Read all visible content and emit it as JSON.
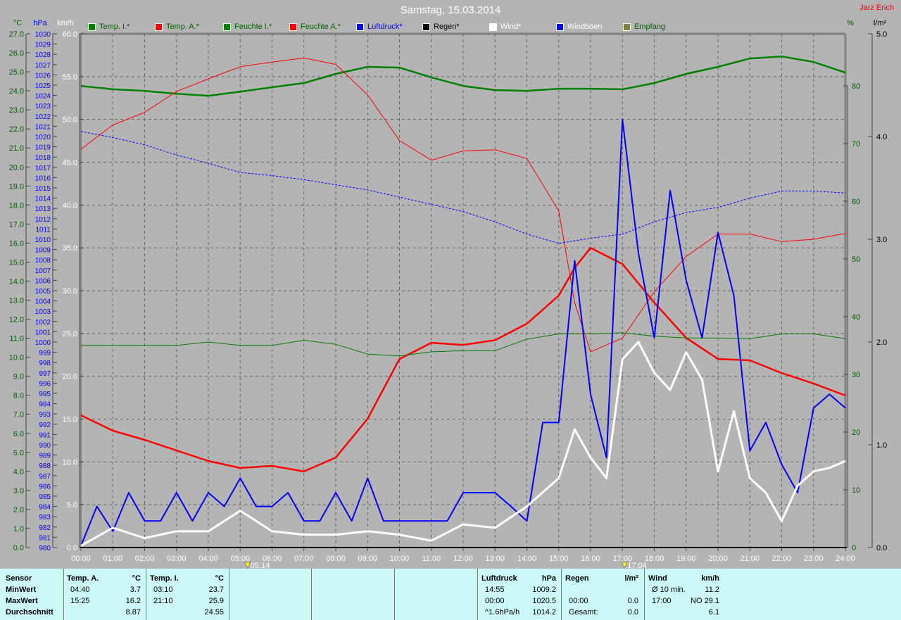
{
  "title": "Samstag, 15.03.2014",
  "author": "Jarz Erich",
  "legend": [
    {
      "label": "Temp. I.*",
      "color": "#008000",
      "text": "#006000"
    },
    {
      "label": "Temp. A.*",
      "color": "#ff0000",
      "text": "#006000"
    },
    {
      "label": "Feuchte I.*",
      "color": "#008000",
      "text": "#006000"
    },
    {
      "label": "Feuchte A.*",
      "color": "#ff0000",
      "text": "#006000"
    },
    {
      "label": "Luftdruck*",
      "color": "#0000ff",
      "text": "#0000ff"
    },
    {
      "label": "Regen*",
      "color": "#000000",
      "text": "#000000"
    },
    {
      "label": "Wind*",
      "color": "#ffffff",
      "text": "#ffffff"
    },
    {
      "label": "Windböen",
      "color": "#0000ff",
      "text": "#ffffff"
    },
    {
      "label": "Empfang",
      "color": "#808040",
      "text": "#006000"
    }
  ],
  "markers": {
    "sunrise": "05:14",
    "sunset": "17:04"
  },
  "chart_data": {
    "type": "line",
    "title": "Samstag, 15.03.2014",
    "x_labels": [
      "00:00",
      "01:00",
      "02:00",
      "03:00",
      "04:00",
      "05:00",
      "06:00",
      "07:00",
      "08:00",
      "09:00",
      "10:00",
      "11:00",
      "12:00",
      "13:00",
      "14:00",
      "15:00",
      "16:00",
      "17:00",
      "18:00",
      "19:00",
      "20:00",
      "21:00",
      "22:00",
      "23:00",
      "24:00"
    ],
    "xlim": [
      0,
      24
    ],
    "axes": {
      "celsius": {
        "unit": "°C",
        "range": [
          0,
          27
        ],
        "ticks": [
          "0.0",
          "1.0",
          "2.0",
          "3.0",
          "4.0",
          "5.0",
          "6.0",
          "7.0",
          "8.0",
          "9.0",
          "10.0",
          "11.0",
          "12.0",
          "13.0",
          "14.0",
          "15.0",
          "16.0",
          "17.0",
          "18.0",
          "19.0",
          "20.0",
          "21.0",
          "22.0",
          "23.0",
          "24.0",
          "25.0",
          "26.0",
          "27.0"
        ]
      },
      "hpa": {
        "unit": "hPa",
        "range": [
          980,
          1030
        ],
        "ticks": [
          "980",
          "981",
          "982",
          "983",
          "984",
          "985",
          "986",
          "987",
          "988",
          "989",
          "990",
          "991",
          "992",
          "993",
          "994",
          "995",
          "996",
          "997",
          "998",
          "999",
          "1000",
          "1001",
          "1002",
          "1003",
          "1004",
          "1005",
          "1006",
          "1007",
          "1008",
          "1009",
          "1010",
          "1011",
          "1012",
          "1013",
          "1014",
          "1015",
          "1016",
          "1017",
          "1018",
          "1019",
          "1020",
          "1021",
          "1022",
          "1023",
          "1024",
          "1025",
          "1026",
          "1027",
          "1028",
          "1029",
          "1030"
        ]
      },
      "kmh": {
        "unit": "km/h",
        "range": [
          0,
          60
        ],
        "ticks": [
          "0.0",
          "5.0",
          "10.0",
          "15.0",
          "20.0",
          "25.0",
          "30.0",
          "35.0",
          "40.0",
          "45.0",
          "50.0",
          "55.0",
          "60.0"
        ]
      },
      "percent": {
        "unit": "%",
        "range": [
          0,
          89
        ],
        "ticks": [
          "0",
          "10",
          "20",
          "30",
          "40",
          "50",
          "60",
          "70",
          "80"
        ]
      },
      "rain": {
        "unit": "l/m²",
        "range": [
          0,
          5
        ],
        "ticks": [
          "0.0",
          "1.0",
          "2.0",
          "3.0",
          "4.0",
          "5.0"
        ]
      }
    },
    "series": [
      {
        "name": "Temp. A.",
        "axis": "celsius",
        "color": "#ff0000",
        "width": 2.5,
        "x": [
          0,
          1,
          2,
          3,
          4,
          5,
          6,
          7,
          8,
          9,
          10,
          11,
          12,
          13,
          14,
          15,
          15.5,
          16,
          17,
          18,
          19,
          20,
          21,
          22,
          23,
          24
        ],
        "y": [
          6.95,
          6.14,
          5.66,
          5.1,
          4.55,
          4.18,
          4.29,
          4.0,
          4.73,
          6.77,
          9.91,
          10.76,
          10.65,
          10.9,
          11.76,
          13.24,
          14.7,
          15.75,
          14.9,
          12.87,
          11.02,
          9.91,
          9.84,
          9.17,
          8.62,
          7.99
        ]
      },
      {
        "name": "Temp. I.",
        "axis": "celsius",
        "color": "#008000",
        "width": 2.5,
        "x": [
          0,
          1,
          2,
          3,
          4,
          5,
          6,
          7,
          8,
          9,
          10,
          11,
          12,
          13,
          14,
          15,
          16,
          17,
          18,
          19,
          20,
          21,
          22,
          23,
          24
        ],
        "y": [
          24.26,
          24.08,
          24.0,
          23.85,
          23.74,
          23.96,
          24.19,
          24.41,
          24.89,
          25.26,
          25.22,
          24.71,
          24.26,
          24.04,
          24.0,
          24.11,
          24.11,
          24.08,
          24.41,
          24.89,
          25.26,
          25.7,
          25.81,
          25.52,
          24.96
        ]
      },
      {
        "name": "Feuchte A.",
        "axis": "percent",
        "color": "#ff0000",
        "width": 1,
        "x": [
          0,
          1,
          2,
          3,
          4,
          5,
          6,
          7,
          8,
          9,
          10,
          11,
          12,
          13,
          14,
          15,
          15.5,
          16,
          17,
          18,
          19,
          20,
          21,
          22,
          23,
          24
        ],
        "y": [
          69.0,
          73.2,
          75.4,
          79.0,
          81.2,
          83.3,
          84.1,
          84.8,
          83.7,
          78.4,
          70.5,
          67.1,
          68.7,
          68.9,
          67.4,
          58.3,
          42.4,
          33.9,
          36.3,
          44.3,
          50.4,
          54.3,
          54.3,
          53.0,
          53.4,
          54.4
        ]
      },
      {
        "name": "Feuchte I.",
        "axis": "percent",
        "color": "#008000",
        "width": 1,
        "x": [
          0,
          3,
          4,
          5,
          6,
          7,
          8,
          9,
          10,
          11,
          12,
          13,
          14,
          15,
          16,
          17,
          18,
          19,
          20,
          21,
          22,
          23,
          24
        ],
        "y": [
          35.0,
          35.0,
          35.6,
          35.0,
          35.0,
          35.9,
          35.2,
          33.5,
          33.2,
          33.9,
          34.1,
          34.1,
          36.1,
          37.0,
          37.0,
          37.2,
          36.6,
          36.3,
          36.3,
          36.2,
          37.0,
          37.0,
          36.2
        ]
      },
      {
        "name": "Luftdruck",
        "axis": "hpa",
        "color": "#0000ff",
        "width": 1,
        "dash": "3,2",
        "x": [
          0,
          1,
          2,
          3,
          4,
          5,
          6,
          7,
          8,
          9,
          10,
          11,
          12,
          13,
          14,
          15,
          16,
          17,
          18,
          19,
          20,
          21,
          22,
          23,
          24
        ],
        "y": [
          1020.5,
          1019.9,
          1019.2,
          1018.2,
          1017.4,
          1016.5,
          1016.2,
          1015.8,
          1015.3,
          1014.8,
          1014.1,
          1013.4,
          1012.7,
          1011.7,
          1010.5,
          1009.6,
          1010.1,
          1010.5,
          1011.7,
          1012.6,
          1013.1,
          1014.0,
          1014.7,
          1014.7,
          1014.5
        ]
      },
      {
        "name": "Windböen",
        "axis": "kmh",
        "color": "#0000ff",
        "width": 2,
        "x": [
          0,
          0.5,
          1,
          1.5,
          2,
          2.5,
          3,
          3.5,
          4,
          4.5,
          5,
          5.5,
          6,
          6.5,
          7,
          7.5,
          8,
          8.5,
          9,
          9.5,
          10,
          10.5,
          11,
          11.5,
          12,
          12.5,
          13,
          13.5,
          14,
          14.5,
          15,
          15.5,
          16,
          16.5,
          17,
          17.5,
          18,
          18.5,
          19,
          19.5,
          20,
          20.5,
          21,
          21.5,
          22,
          22.5,
          23,
          23.5,
          24
        ],
        "y": [
          0.2,
          4.8,
          1.9,
          6.4,
          3.1,
          3.1,
          6.4,
          3.1,
          6.4,
          4.8,
          8.1,
          4.8,
          4.8,
          6.4,
          3.1,
          3.1,
          6.4,
          3.1,
          8.1,
          3.1,
          3.1,
          3.1,
          3.1,
          3.1,
          6.4,
          6.4,
          6.4,
          4.8,
          3.1,
          14.6,
          14.6,
          33.5,
          17.9,
          10.5,
          50.0,
          34.4,
          24.5,
          41.7,
          31.2,
          24.5,
          36.8,
          29.4,
          11.3,
          14.6,
          9.7,
          6.4,
          16.3,
          17.9,
          16.3
        ]
      },
      {
        "name": "Wind",
        "axis": "kmh",
        "color": "#ffffff",
        "width": 3,
        "x": [
          0,
          1,
          2,
          3,
          4,
          5,
          6,
          7,
          8,
          9,
          10,
          11,
          12,
          13,
          14,
          15,
          15.5,
          16,
          16.5,
          17,
          17.5,
          18,
          18.5,
          19,
          19.5,
          20,
          20.5,
          21,
          21.5,
          22,
          22.5,
          23,
          23.5,
          24
        ],
        "y": [
          0.2,
          2.3,
          1.1,
          1.9,
          1.9,
          4.3,
          1.9,
          1.5,
          1.5,
          1.9,
          1.5,
          0.8,
          2.7,
          2.3,
          4.8,
          8.1,
          13.8,
          10.5,
          8.1,
          22.0,
          24.0,
          20.4,
          18.4,
          22.8,
          19.6,
          8.9,
          15.9,
          8.1,
          6.4,
          3.1,
          7.2,
          8.9,
          9.3,
          10.1
        ]
      },
      {
        "name": "Regen",
        "axis": "rain",
        "color": "#000000",
        "width": 1,
        "x": [
          0,
          24
        ],
        "y": [
          0,
          0
        ]
      }
    ]
  },
  "table": {
    "sensor": {
      "header": "Sensor",
      "rows": [
        "MinWert",
        "MaxWert",
        "Durchschnitt"
      ]
    },
    "temp_a": {
      "header": "Temp. A.",
      "unit": "°C",
      "rows": [
        [
          "04:40",
          "3.7"
        ],
        [
          "15:25",
          "16.2"
        ],
        [
          "",
          "8.87"
        ]
      ]
    },
    "temp_i": {
      "header": "Temp. I.",
      "unit": "°C",
      "rows": [
        [
          "03:10",
          "23.7"
        ],
        [
          "21:10",
          "25.9"
        ],
        [
          "",
          "24.55"
        ]
      ]
    },
    "luftdruck": {
      "header": "Luftdruck",
      "unit": "hPa",
      "rows": [
        [
          "14:55",
          "1009.2"
        ],
        [
          "00:00",
          "1020.5"
        ],
        [
          "^1.6hPa/h",
          "1014.2"
        ]
      ]
    },
    "regen": {
      "header": "Regen",
      "unit": "l/m²",
      "rows": [
        [
          "",
          ""
        ],
        [
          "00:00",
          "0.0"
        ],
        [
          "Gesamt:",
          "0.0"
        ]
      ]
    },
    "wind": {
      "header": "Wind",
      "unit": "km/h",
      "rows": [
        [
          "Ø 10 min.",
          "11.2"
        ],
        [
          "17:00",
          "NO 29.1"
        ],
        [
          "",
          "6.1"
        ]
      ]
    }
  }
}
